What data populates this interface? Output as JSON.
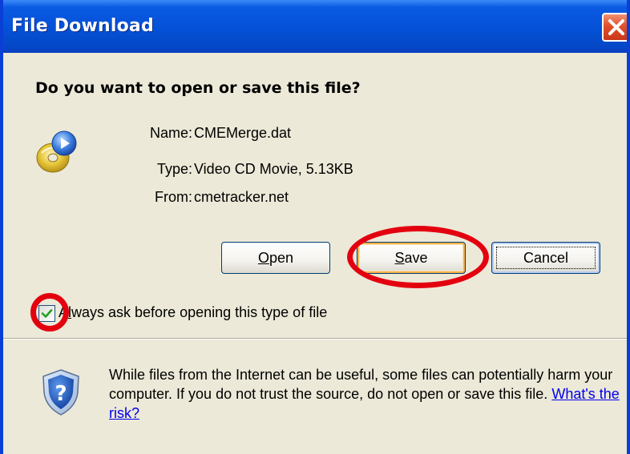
{
  "window": {
    "title": "File Download"
  },
  "dialog": {
    "question": "Do you want to open or save this file?",
    "file_info": [
      {
        "label": "Name:",
        "value": "CMEMerge.dat"
      },
      {
        "label": "Type:",
        "value": "Video CD Movie, 5.13KB"
      },
      {
        "label": "From:",
        "value": "cmetracker.net"
      }
    ],
    "buttons": {
      "open": {
        "mnemonic": "O",
        "rest": "pen"
      },
      "save": {
        "mnemonic": "S",
        "rest": "ave"
      },
      "cancel": {
        "label": "Cancel"
      }
    },
    "checkbox": {
      "checked": true,
      "label_prefix": "A",
      "label_mnemonic": "l",
      "label_rest": "ways ask before opening this type of file"
    },
    "warning": {
      "text": "While files from the Internet can be useful, some files can potentially harm your computer. If you do not trust the source, do not open or save this file.",
      "link": "What's the risk?"
    }
  },
  "icons": {
    "file": "video-cd-icon",
    "warning": "security-shield-icon",
    "close": "close-icon",
    "check": "checkmark-icon"
  },
  "colors": {
    "title_bar": "#0451d6",
    "close_button": "#e0502b",
    "dialog_background": "#ece9d8",
    "annotation": "#e3000f",
    "link": "#0000ee"
  }
}
